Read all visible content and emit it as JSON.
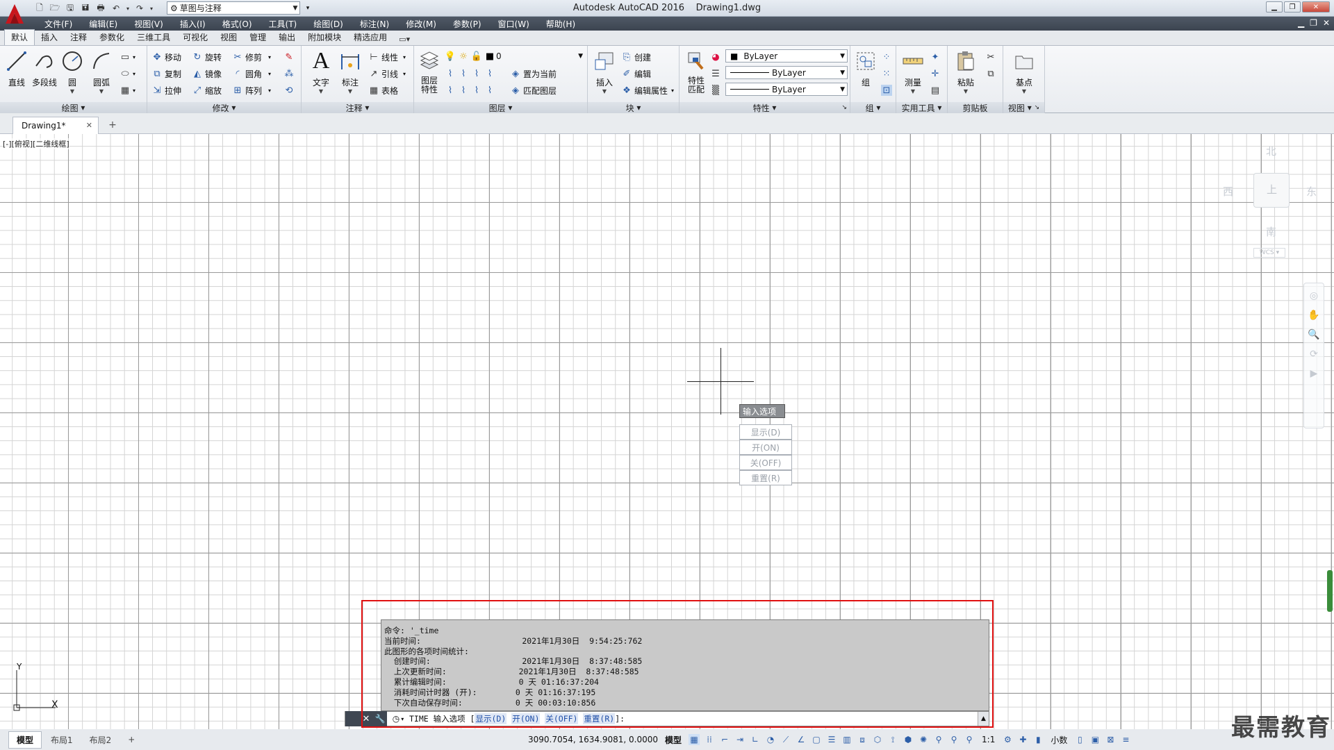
{
  "titlebar": {
    "app_title": "Autodesk AutoCAD 2016",
    "file_title": "Drawing1.dwg",
    "workspace": "草图与注释"
  },
  "menus": [
    "文件(F)",
    "编辑(E)",
    "视图(V)",
    "插入(I)",
    "格式(O)",
    "工具(T)",
    "绘图(D)",
    "标注(N)",
    "修改(M)",
    "参数(P)",
    "窗口(W)",
    "帮助(H)"
  ],
  "ribbon_tabs": [
    "默认",
    "插入",
    "注释",
    "参数化",
    "三维工具",
    "可视化",
    "视图",
    "管理",
    "输出",
    "附加模块",
    "精选应用"
  ],
  "ribbon": {
    "draw": {
      "title": "绘图",
      "line": "直线",
      "polyline": "多段线",
      "circle": "圆",
      "arc": "圆弧"
    },
    "modify": {
      "title": "修改",
      "move": "移动",
      "rotate": "旋转",
      "trim": "修剪",
      "copy": "复制",
      "mirror": "镜像",
      "fillet": "圆角",
      "stretch": "拉伸",
      "scale": "缩放",
      "array": "阵列"
    },
    "annotation": {
      "title": "注释",
      "text": "文字",
      "dimension": "标注",
      "linear": "线性",
      "leader": "引线",
      "table": "表格"
    },
    "layers": {
      "title": "图层",
      "properties": "图层\n特性",
      "current_layer": "0",
      "set_current": "置为当前",
      "match_layer": "匹配图层"
    },
    "block": {
      "title": "块",
      "insert": "插入",
      "create": "创建",
      "edit": "编辑",
      "edit_attr": "编辑属性"
    },
    "properties": {
      "title": "特性",
      "match": "特性\n匹配",
      "color": "ByLayer",
      "linetype": "ByLayer",
      "lineweight": "ByLayer"
    },
    "groups": {
      "title": "组",
      "group": "组"
    },
    "utilities": {
      "title": "实用工具",
      "measure": "测量"
    },
    "clipboard": {
      "title": "剪贴板",
      "paste": "粘贴"
    },
    "view": {
      "title": "视图",
      "base": "基点"
    }
  },
  "document_tab": "Drawing1*",
  "viewport_label": "[-][俯视][二维线框]",
  "viewcube": {
    "north": "北",
    "south": "南",
    "east": "东",
    "west": "西",
    "top": "上",
    "wcs": "WCS"
  },
  "ucs": {
    "x": "X",
    "y": "Y"
  },
  "dynamic_input": {
    "prompt": "输入选项",
    "options": [
      "显示(D)",
      "开(ON)",
      "关(OFF)",
      "重置(R)"
    ]
  },
  "command_history": [
    "命令: '_time",
    "当前时间:                     2021年1月30日  9:54:25:762",
    "此图形的各项时间统计:",
    "  创建时间:                   2021年1月30日  8:37:48:585",
    "  上次更新时间:               2021年1月30日  8:37:48:585",
    "  累计编辑时间:               0 天 01:16:37:204",
    "  消耗时间计时器 (开):        0 天 01:16:37:195",
    "  下次自动保存时间:           0 天 00:03:10:856"
  ],
  "command_line": {
    "command": "TIME",
    "prompt": " 输入选项 [",
    "opt_display": "显示(D)",
    "opt_on": "开(ON)",
    "opt_off": "关(OFF)",
    "opt_reset": "重置(R)",
    "suffix": "]:"
  },
  "layout_tabs": [
    "模型",
    "布局1",
    "布局2"
  ],
  "statusbar": {
    "coords": "3090.7054, 1634.9081, 0.0000",
    "space": "模型",
    "annot_scale": "1:1",
    "units": "小数"
  },
  "watermark": "最需教育"
}
